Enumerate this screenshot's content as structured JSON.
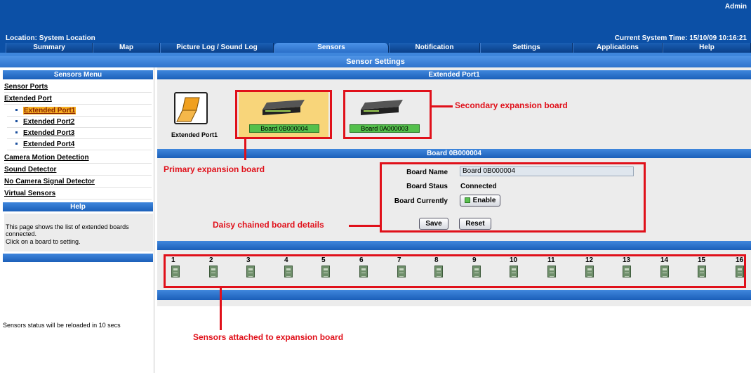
{
  "header": {
    "user": "Admin",
    "location": "Location: System Location",
    "system_time": "Current System Time: 15/10/09 10:16:21"
  },
  "tabs": [
    {
      "label": "Summary"
    },
    {
      "label": "Map"
    },
    {
      "label": "Picture Log / Sound Log"
    },
    {
      "label": "Sensors",
      "active": true
    },
    {
      "label": "Notification"
    },
    {
      "label": "Settings"
    },
    {
      "label": "Applications"
    },
    {
      "label": "Help"
    }
  ],
  "page_title": "Sensor Settings",
  "sidebar": {
    "menu_title": "Sensors Menu",
    "items": [
      {
        "label": "Sensor Ports"
      },
      {
        "label": "Extended Port"
      },
      {
        "label": "Extended Port1",
        "active": true
      },
      {
        "label": "Extended Port2"
      },
      {
        "label": "Extended Port3"
      },
      {
        "label": "Extended Port4"
      },
      {
        "label": "Camera Motion Detection"
      },
      {
        "label": "Sound Detector"
      },
      {
        "label": "No Camera Signal Detector"
      },
      {
        "label": "Virtual Sensors"
      }
    ],
    "help_title": "Help",
    "help_text_1": "This page shows the list of extended boards connected.",
    "help_text_2": "Click on a board to setting.",
    "reload_status": "Sensors status will be reloaded in 10 secs"
  },
  "main": {
    "port_header": "Extended Port1",
    "port_label": "Extended Port1",
    "boards": [
      {
        "label": "Board 0B000004",
        "selected": true
      },
      {
        "label": "Board 0A000003",
        "selected": false
      }
    ],
    "board_header": "Board 0B000004",
    "form": {
      "name_label": "Board Name",
      "name_value": "Board 0B000004",
      "status_label": "Board Staus",
      "status_value": "Connected",
      "currently_label": "Board Currently",
      "enable_label": "Enable",
      "save_label": "Save",
      "reset_label": "Reset"
    },
    "sensors": [
      "1",
      "2",
      "3",
      "4",
      "5",
      "6",
      "7",
      "8",
      "9",
      "10",
      "11",
      "12",
      "13",
      "14",
      "15",
      "16"
    ]
  },
  "annotations": {
    "secondary": "Secondary expansion board",
    "primary": "Primary expansion board",
    "daisy": "Daisy chained board details",
    "sensors": "Sensors attached to expansion board"
  },
  "colors": {
    "header_blue": "#0c50a6",
    "annotation_red": "#e0101a",
    "selected_board_bg": "#f8d57a",
    "board_label_green": "#54c04c",
    "active_menu_highlight": "#f6b023"
  }
}
